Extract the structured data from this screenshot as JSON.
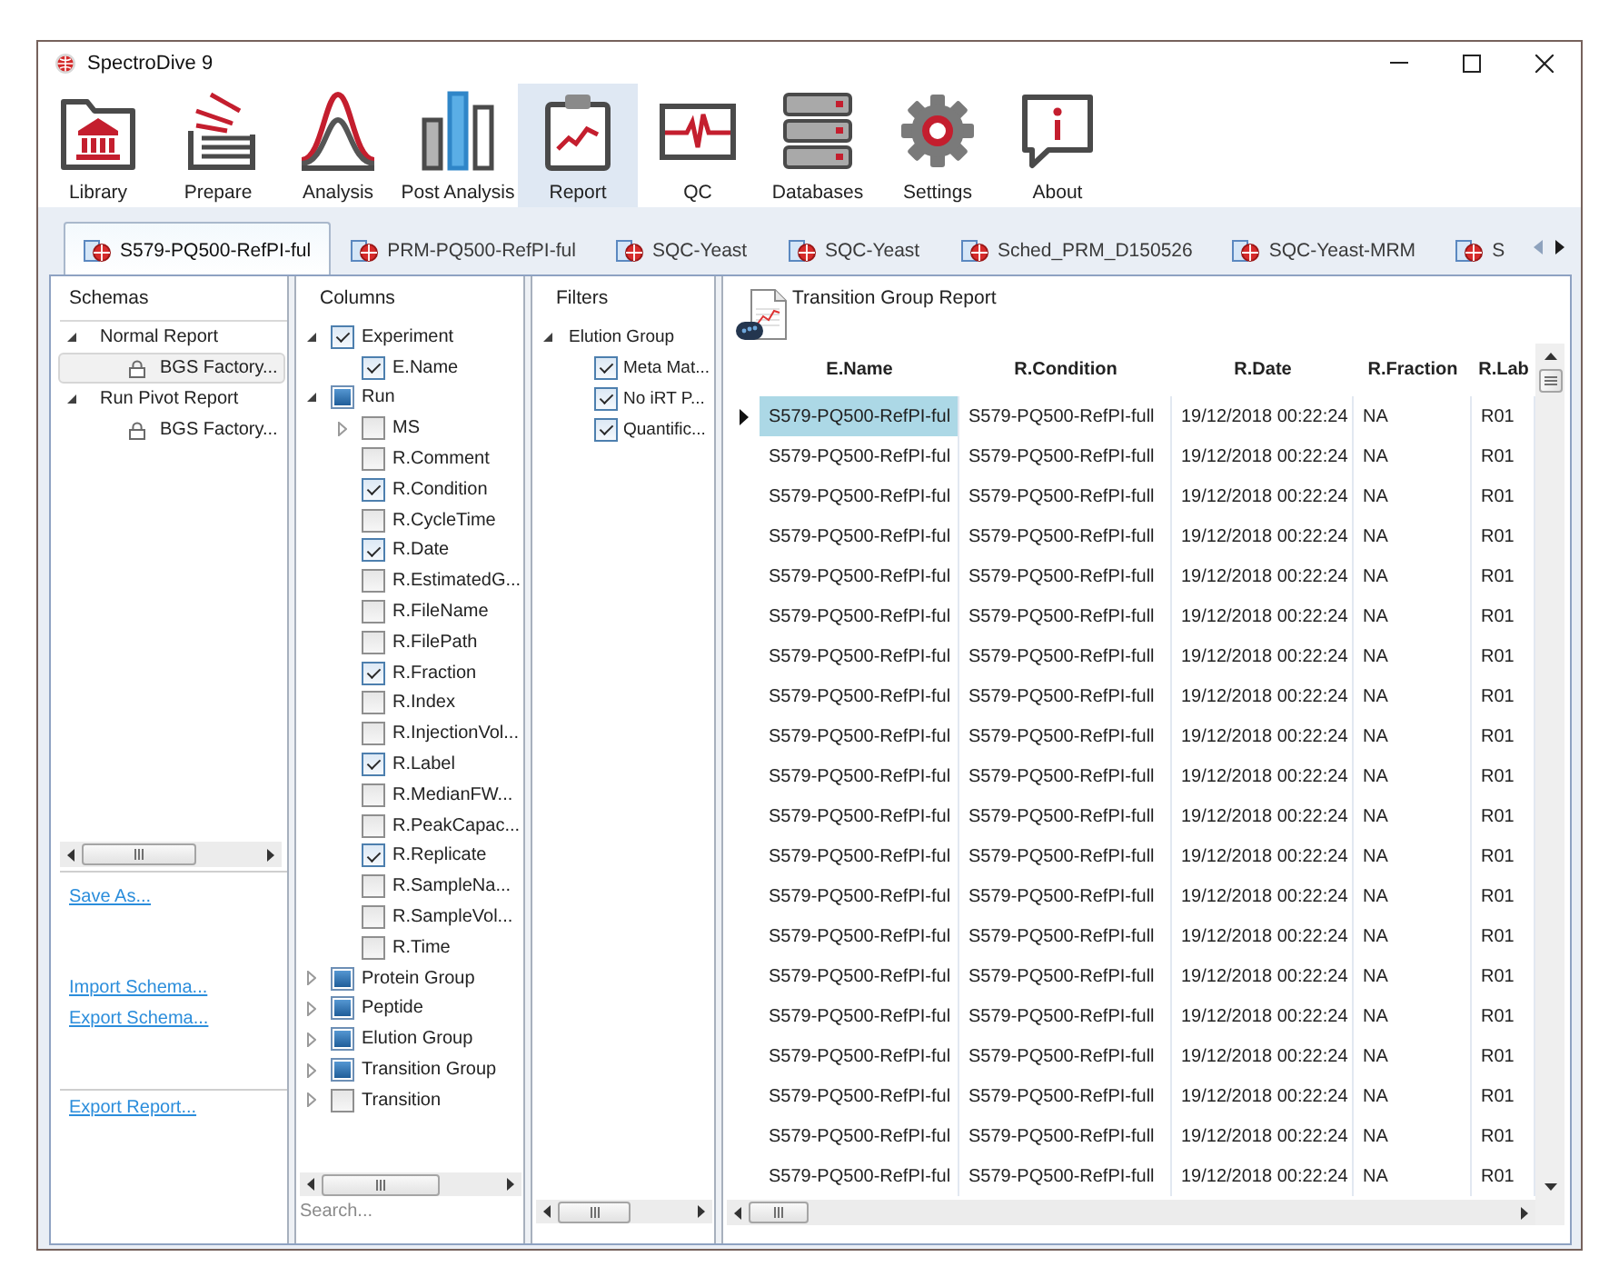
{
  "window": {
    "title": "SpectroDive 9"
  },
  "toolbar": [
    {
      "label": "Library",
      "selected": false
    },
    {
      "label": "Prepare",
      "selected": false
    },
    {
      "label": "Analysis",
      "selected": false
    },
    {
      "label": "Post Analysis",
      "selected": false
    },
    {
      "label": "Report",
      "selected": true
    },
    {
      "label": "QC",
      "selected": false
    },
    {
      "label": "Databases",
      "selected": false
    },
    {
      "label": "Settings",
      "selected": false
    },
    {
      "label": "About",
      "selected": false
    }
  ],
  "tabs": [
    {
      "label": "S579-PQ500-RefPI-ful",
      "selected": true
    },
    {
      "label": "PRM-PQ500-RefPI-ful",
      "selected": false
    },
    {
      "label": "SQC-Yeast",
      "selected": false
    },
    {
      "label": "SQC-Yeast",
      "selected": false
    },
    {
      "label": "Sched_PRM_D150526",
      "selected": false
    },
    {
      "label": "SQC-Yeast-MRM",
      "selected": false
    },
    {
      "label": "S",
      "selected": false
    }
  ],
  "tab_scroll": {
    "back_disabled": true,
    "forward_disabled": false
  },
  "schemas": {
    "title": "Schemas",
    "items": [
      {
        "label": "Normal Report",
        "expanded": true,
        "selected": false,
        "children": [
          {
            "label": "BGS Factory...",
            "selected": true
          }
        ]
      },
      {
        "label": "Run Pivot Report",
        "expanded": true,
        "selected": false,
        "children": [
          {
            "label": "BGS Factory...",
            "selected": false
          }
        ]
      }
    ],
    "links_top": [
      "Save As..."
    ],
    "links_middle": [
      "Import Schema...",
      "Export Schema..."
    ],
    "links_bottom": [
      "Export Report..."
    ]
  },
  "columns": {
    "title": "Columns",
    "items": [
      {
        "label": "Experiment",
        "checked": true,
        "partial": false,
        "expanded": true,
        "children": [
          {
            "label": "E.Name",
            "checked": true
          }
        ]
      },
      {
        "label": "Run",
        "checked": false,
        "partial": true,
        "expanded": true,
        "children": [
          {
            "label": "MS",
            "checked": false,
            "expanded": false
          },
          {
            "label": "R.Comment",
            "checked": false
          },
          {
            "label": "R.Condition",
            "checked": true
          },
          {
            "label": "R.CycleTime",
            "checked": false
          },
          {
            "label": "R.Date",
            "checked": true
          },
          {
            "label": "R.EstimatedG...",
            "checked": false
          },
          {
            "label": "R.FileName",
            "checked": false
          },
          {
            "label": "R.FilePath",
            "checked": false
          },
          {
            "label": "R.Fraction",
            "checked": true
          },
          {
            "label": "R.Index",
            "checked": false
          },
          {
            "label": "R.InjectionVol...",
            "checked": false
          },
          {
            "label": "R.Label",
            "checked": true
          },
          {
            "label": "R.MedianFW...",
            "checked": false
          },
          {
            "label": "R.PeakCapac...",
            "checked": false
          },
          {
            "label": "R.Replicate",
            "checked": true
          },
          {
            "label": "R.SampleNa...",
            "checked": false
          },
          {
            "label": "R.SampleVol...",
            "checked": false
          },
          {
            "label": "R.Time",
            "checked": false
          }
        ]
      },
      {
        "label": "Protein Group",
        "checked": false,
        "partial": true,
        "expanded": false
      },
      {
        "label": "Peptide",
        "checked": false,
        "partial": true,
        "expanded": false
      },
      {
        "label": "Elution Group",
        "checked": false,
        "partial": true,
        "expanded": false
      },
      {
        "label": "Transition Group",
        "checked": false,
        "partial": true,
        "expanded": false
      },
      {
        "label": "Transition",
        "checked": false,
        "partial": false,
        "expanded": false
      }
    ],
    "search": {
      "placeholder": "Search..."
    }
  },
  "filters": {
    "title": "Filters",
    "items": [
      {
        "label": "Elution Group",
        "expanded": true,
        "children": [
          {
            "label": "Meta Mat...",
            "checked": true
          },
          {
            "label": "No iRT P...",
            "checked": true
          },
          {
            "label": "Quantific...",
            "checked": true
          }
        ]
      }
    ]
  },
  "report": {
    "title": "Transition Group Report",
    "columns": [
      "E.Name",
      "R.Condition",
      "R.Date",
      "R.Fraction",
      "R.Lab"
    ],
    "rows": [
      {
        "selected": true,
        "cells": [
          "S579-PQ500-RefPI-ful",
          "S579-PQ500-RefPI-full",
          "19/12/2018 00:22:24",
          "NA",
          "R01"
        ]
      },
      {
        "selected": false,
        "cells": [
          "S579-PQ500-RefPI-ful",
          "S579-PQ500-RefPI-full",
          "19/12/2018 00:22:24",
          "NA",
          "R01"
        ]
      },
      {
        "selected": false,
        "cells": [
          "S579-PQ500-RefPI-ful",
          "S579-PQ500-RefPI-full",
          "19/12/2018 00:22:24",
          "NA",
          "R01"
        ]
      },
      {
        "selected": false,
        "cells": [
          "S579-PQ500-RefPI-ful",
          "S579-PQ500-RefPI-full",
          "19/12/2018 00:22:24",
          "NA",
          "R01"
        ]
      },
      {
        "selected": false,
        "cells": [
          "S579-PQ500-RefPI-ful",
          "S579-PQ500-RefPI-full",
          "19/12/2018 00:22:24",
          "NA",
          "R01"
        ]
      },
      {
        "selected": false,
        "cells": [
          "S579-PQ500-RefPI-ful",
          "S579-PQ500-RefPI-full",
          "19/12/2018 00:22:24",
          "NA",
          "R01"
        ]
      },
      {
        "selected": false,
        "cells": [
          "S579-PQ500-RefPI-ful",
          "S579-PQ500-RefPI-full",
          "19/12/2018 00:22:24",
          "NA",
          "R01"
        ]
      },
      {
        "selected": false,
        "cells": [
          "S579-PQ500-RefPI-ful",
          "S579-PQ500-RefPI-full",
          "19/12/2018 00:22:24",
          "NA",
          "R01"
        ]
      },
      {
        "selected": false,
        "cells": [
          "S579-PQ500-RefPI-ful",
          "S579-PQ500-RefPI-full",
          "19/12/2018 00:22:24",
          "NA",
          "R01"
        ]
      },
      {
        "selected": false,
        "cells": [
          "S579-PQ500-RefPI-ful",
          "S579-PQ500-RefPI-full",
          "19/12/2018 00:22:24",
          "NA",
          "R01"
        ]
      },
      {
        "selected": false,
        "cells": [
          "S579-PQ500-RefPI-ful",
          "S579-PQ500-RefPI-full",
          "19/12/2018 00:22:24",
          "NA",
          "R01"
        ]
      },
      {
        "selected": false,
        "cells": [
          "S579-PQ500-RefPI-ful",
          "S579-PQ500-RefPI-full",
          "19/12/2018 00:22:24",
          "NA",
          "R01"
        ]
      },
      {
        "selected": false,
        "cells": [
          "S579-PQ500-RefPI-ful",
          "S579-PQ500-RefPI-full",
          "19/12/2018 00:22:24",
          "NA",
          "R01"
        ]
      },
      {
        "selected": false,
        "cells": [
          "S579-PQ500-RefPI-ful",
          "S579-PQ500-RefPI-full",
          "19/12/2018 00:22:24",
          "NA",
          "R01"
        ]
      },
      {
        "selected": false,
        "cells": [
          "S579-PQ500-RefPI-ful",
          "S579-PQ500-RefPI-full",
          "19/12/2018 00:22:24",
          "NA",
          "R01"
        ]
      },
      {
        "selected": false,
        "cells": [
          "S579-PQ500-RefPI-ful",
          "S579-PQ500-RefPI-full",
          "19/12/2018 00:22:24",
          "NA",
          "R01"
        ]
      },
      {
        "selected": false,
        "cells": [
          "S579-PQ500-RefPI-ful",
          "S579-PQ500-RefPI-full",
          "19/12/2018 00:22:24",
          "NA",
          "R01"
        ]
      },
      {
        "selected": false,
        "cells": [
          "S579-PQ500-RefPI-ful",
          "S579-PQ500-RefPI-full",
          "19/12/2018 00:22:24",
          "NA",
          "R01"
        ]
      },
      {
        "selected": false,
        "cells": [
          "S579-PQ500-RefPI-ful",
          "S579-PQ500-RefPI-full",
          "19/12/2018 00:22:24",
          "NA",
          "R01"
        ]
      },
      {
        "selected": false,
        "cells": [
          "S579-PQ500-RefPI-ful",
          "S579-PQ500-RefPI-full",
          "19/12/2018 00:22:24",
          "NA",
          "R01"
        ]
      }
    ]
  }
}
